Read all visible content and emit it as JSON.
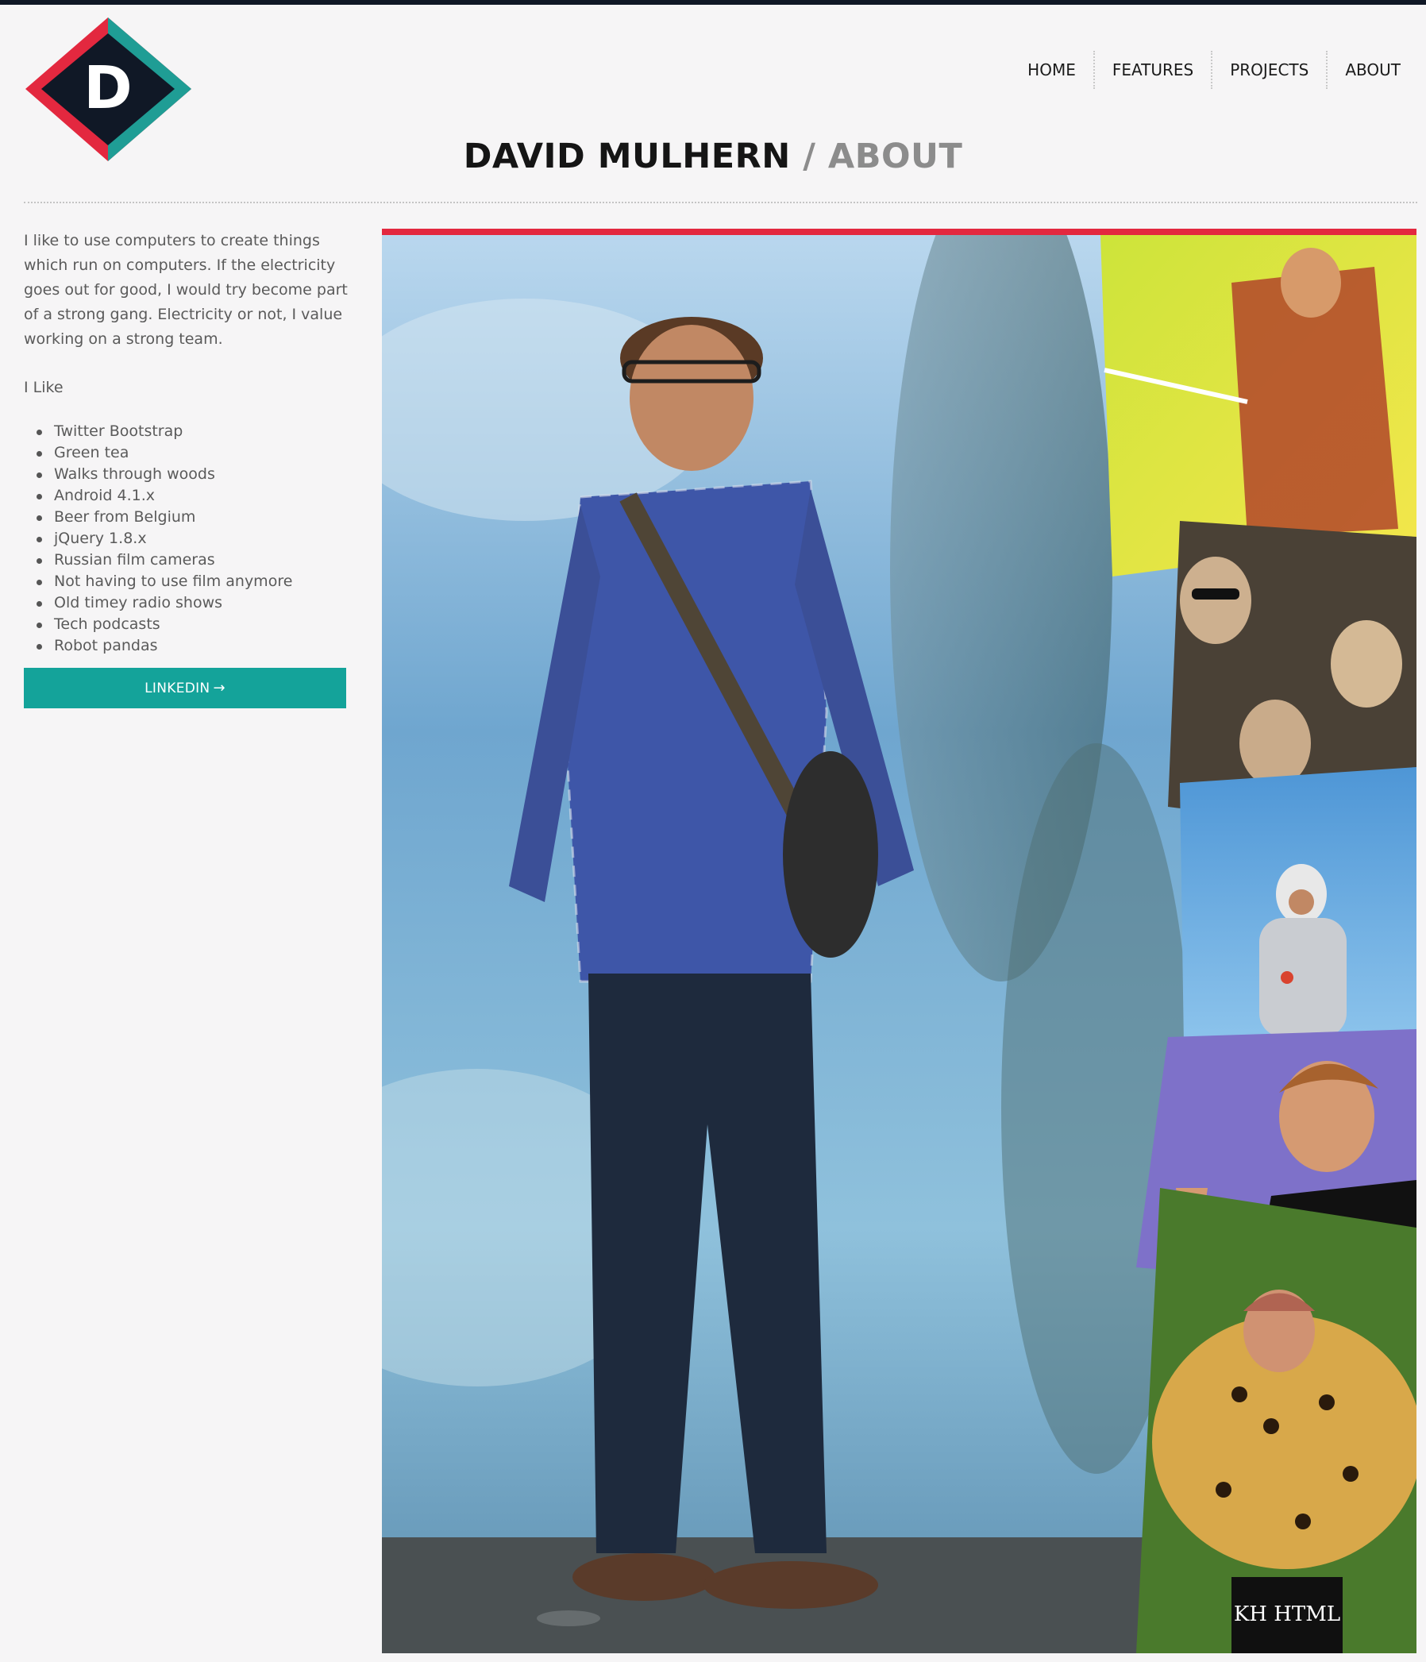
{
  "logo": {
    "letter": "D",
    "alt": "site-logo"
  },
  "nav": {
    "items": [
      {
        "label": "HOME"
      },
      {
        "label": "FEATURES"
      },
      {
        "label": "PROJECTS"
      },
      {
        "label": "ABOUT"
      }
    ]
  },
  "header": {
    "name": "DAVID MULHERN",
    "separator": " / ",
    "section": "ABOUT"
  },
  "sidebar": {
    "intro": "I like to use computers to create things which run on computers. If the electricity goes out for good, I would try become part of a strong gang. Electricity or not, I value working on a strong team.",
    "likes_heading": "I Like",
    "likes": [
      "Twitter Bootstrap",
      "Green tea",
      "Walks through woods",
      "Android 4.1.x",
      "Beer from Belgium",
      "jQuery 1.8.x",
      "Russian film cameras",
      "Not having to use film anymore",
      "Old timey radio shows",
      "Tech podcasts",
      "Robot pandas"
    ],
    "linkedin_label": "LINKEDIN",
    "linkedin_arrow": "→"
  },
  "photo": {
    "description_icon": "photo-collage",
    "collage_text": "KH HTML"
  },
  "colors": {
    "accent_red": "#e3283f",
    "accent_teal": "#14a39a",
    "logo_dark": "#101826",
    "background": "#f6f5f6"
  }
}
